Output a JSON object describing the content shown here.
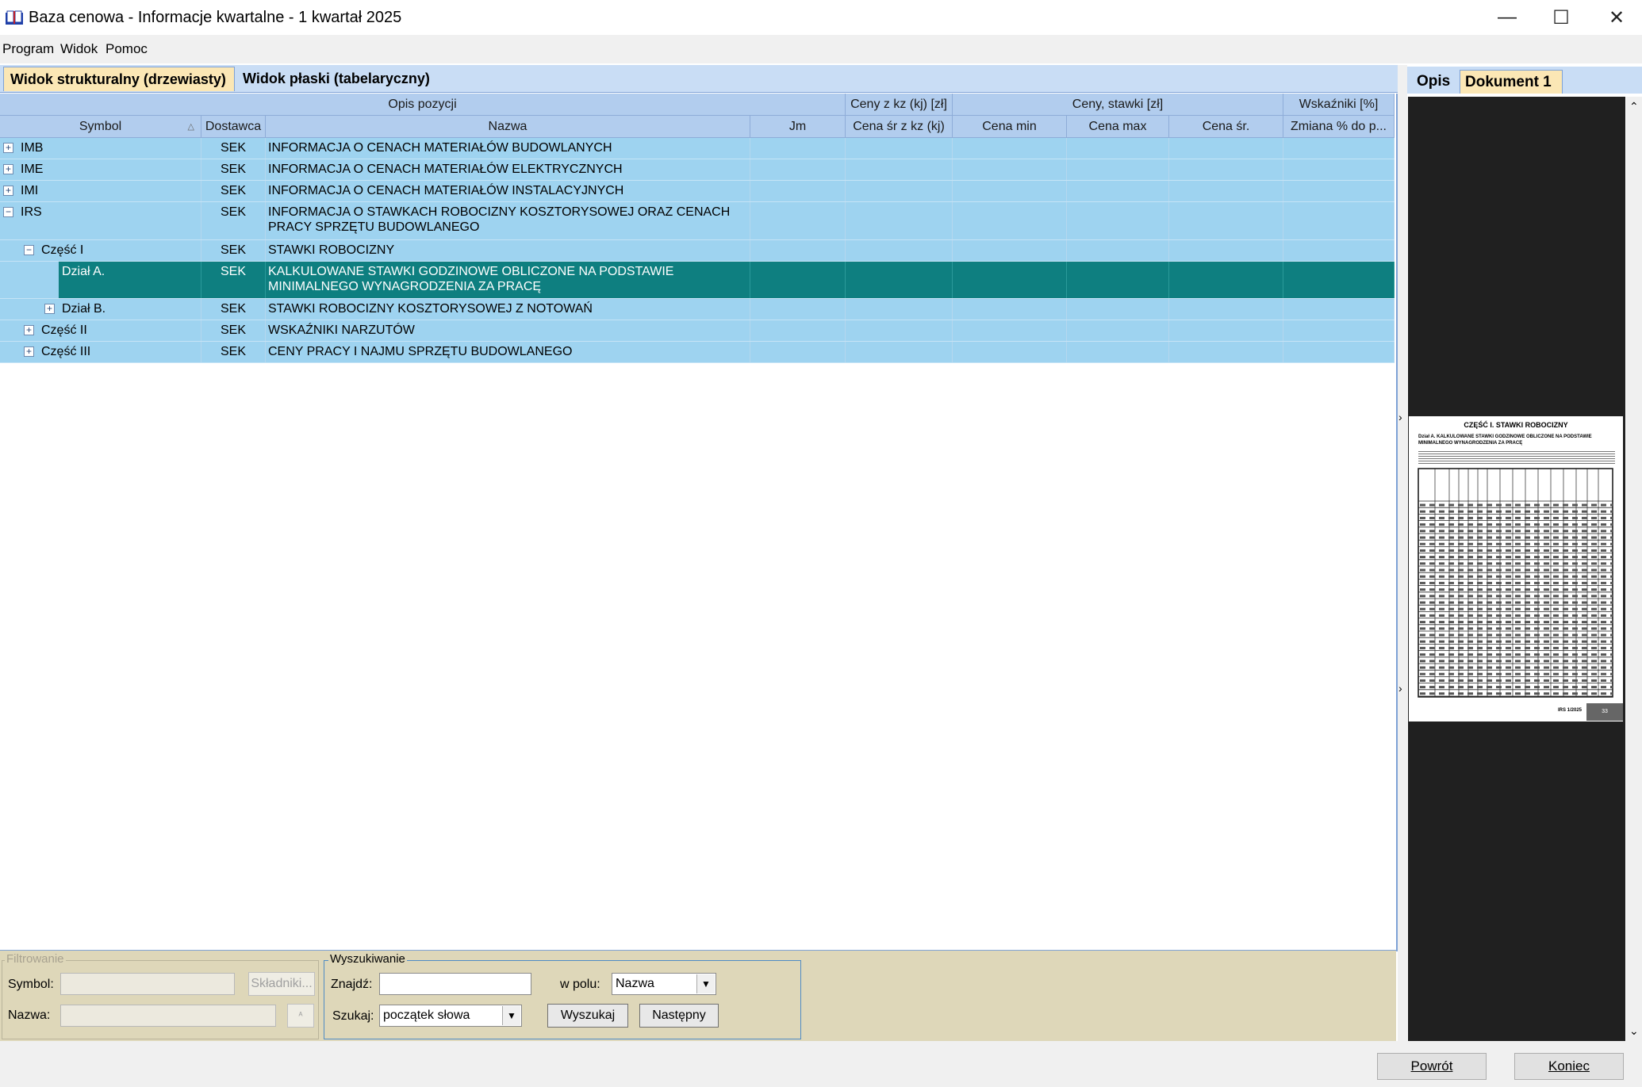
{
  "window": {
    "title": "Baza cenowa - Informacje kwartalne - 1 kwartał 2025",
    "minimize": "—",
    "maximize": "☐",
    "close": "✕"
  },
  "menu": [
    "Program",
    "Widok",
    "Pomoc"
  ],
  "tabs": {
    "structural": "Widok strukturalny (drzewiasty)",
    "flat": "Widok płaski (tabelaryczny)"
  },
  "grid": {
    "group_headers": {
      "opis": "Opis pozycji",
      "ceny_kz": "Ceny z kz (kj) [zł]",
      "ceny_stawki": "Ceny, stawki [zł]",
      "wskazniki": "Wskaźniki [%]"
    },
    "columns": {
      "symbol": "Symbol",
      "dostawca": "Dostawca",
      "nazwa": "Nazwa",
      "jm": "Jm",
      "cena_sr_kz": "Cena śr z kz (kj)",
      "cena_min": "Cena min",
      "cena_max": "Cena max",
      "cena_sr": "Cena śr.",
      "zmiana": "Zmiana % do p..."
    },
    "rows": [
      {
        "symbol": "IMB",
        "dostawca": "SEK",
        "nazwa": "INFORMACJA O CENACH MATERIAŁÓW BUDOWLANYCH",
        "expander": "+"
      },
      {
        "symbol": "IME",
        "dostawca": "SEK",
        "nazwa": "INFORMACJA O CENACH MATERIAŁÓW ELEKTRYCZNYCH",
        "expander": "+"
      },
      {
        "symbol": "IMI",
        "dostawca": "SEK",
        "nazwa": "INFORMACJA O CENACH MATERIAŁÓW INSTALACYJNYCH",
        "expander": "+"
      },
      {
        "symbol": "IRS",
        "dostawca": "SEK",
        "nazwa": "INFORMACJA O STAWKACH ROBOCIZNY KOSZTORYSOWEJ ORAZ CENACH PRACY SPRZĘTU BUDOWLANEGO",
        "expander": "−"
      },
      {
        "symbol": "Część I",
        "dostawca": "SEK",
        "nazwa": "STAWKI ROBOCIZNY",
        "expander": "−"
      },
      {
        "symbol": "Dział A.",
        "dostawca": "SEK",
        "nazwa": "KALKULOWANE STAWKI GODZINOWE OBLICZONE NA PODSTAWIE MINIMALNEGO WYNAGRODZENIA ZA PRACĘ",
        "expander": ""
      },
      {
        "symbol": "Dział B.",
        "dostawca": "SEK",
        "nazwa": "STAWKI ROBOCIZNY KOSZTORYSOWEJ Z NOTOWAŃ",
        "expander": "+"
      },
      {
        "symbol": "Część II",
        "dostawca": "SEK",
        "nazwa": "WSKAŹNIKI NARZUTÓW",
        "expander": "+"
      },
      {
        "symbol": "Część III",
        "dostawca": "SEK",
        "nazwa": "CENY PRACY I NAJMU SPRZĘTU BUDOWLANEGO",
        "expander": "+"
      }
    ]
  },
  "filter": {
    "legend": "Filtrowanie",
    "symbol_label": "Symbol:",
    "nazwa_label": "Nazwa:",
    "skladniki": "Składniki..."
  },
  "search": {
    "legend": "Wyszukiwanie",
    "znajdz_label": "Znajdź:",
    "w_polu_label": "w polu:",
    "w_polu_value": "Nazwa",
    "szukaj_label": "Szukaj:",
    "szukaj_value": "początek słowa",
    "wyszukaj": "Wyszukaj",
    "nastepny": "Następny"
  },
  "right_panel": {
    "tab_opis": "Opis",
    "tab_dokument": "Dokument 1",
    "doc_heading": "CZĘŚĆ I.   STAWKI ROBOCIZNY",
    "doc_subheading": "Dział A.  KALKULOWANE STAWKI GODZINOWE OBLICZONE NA PODSTAWIE MINIMALNEGO WYNAGRODZENIA ZA PRACĘ",
    "doc_footer": "IRS 1/2025",
    "doc_page": "33"
  },
  "footer": {
    "powrot": "Powrót",
    "koniec": "Koniec"
  }
}
